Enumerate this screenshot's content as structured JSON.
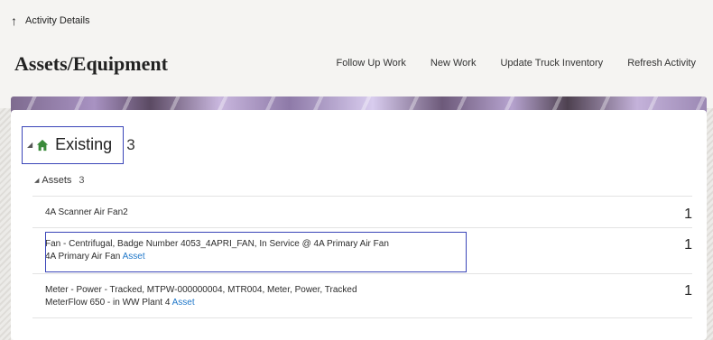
{
  "topbar": {
    "up_icon": "up-arrow-icon",
    "back_label": "Activity Details"
  },
  "header": {
    "title": "Assets/Equipment",
    "actions": [
      "Follow Up Work",
      "New Work",
      "Update Truck Inventory",
      "Refresh Activity"
    ]
  },
  "existing": {
    "label": "Existing",
    "count": "3",
    "icon": "home-icon",
    "icon_color": "#3a8a3a"
  },
  "assets": {
    "label": "Assets",
    "count": "3",
    "items": [
      {
        "line1": "4A Scanner Air Fan2",
        "count": "1"
      },
      {
        "line1": "Fan - Centrifugal, Badge Number 4053_4APRI_FAN, In Service @ 4A Primary Air Fan",
        "line2": "4A Primary Air Fan",
        "link": "Asset",
        "count": "1"
      },
      {
        "line1": "Meter - Power - Tracked, MTPW-000000004, MTR004, Meter, Power, Tracked",
        "line2": "MeterFlow 650 - in WW Plant 4",
        "link": "Asset",
        "count": "1"
      }
    ]
  },
  "colors": {
    "accent": "#1f77c9",
    "highlight_border": "#3a45b8"
  }
}
